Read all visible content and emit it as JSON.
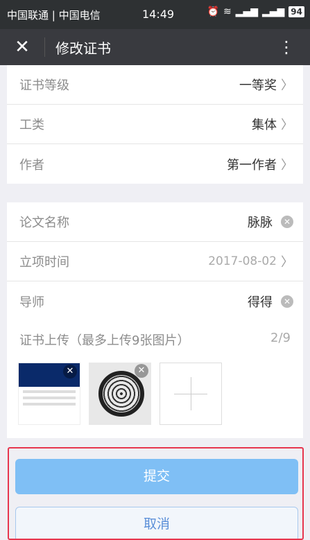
{
  "status_bar": {
    "carriers": "中国联通 | 中国电信",
    "time": "14:49",
    "icons": [
      "alarm-icon",
      "wifi-icon",
      "signal-icon",
      "signal-icon",
      "battery-icon"
    ],
    "battery": "94"
  },
  "nav": {
    "title": "修改证书",
    "close_icon": "close-icon",
    "more_icon": "more-vertical-icon"
  },
  "form": {
    "group1": [
      {
        "label": "证书等级",
        "value": "一等奖"
      },
      {
        "label": "工类",
        "value": "集体"
      },
      {
        "label": "作者",
        "value": "第一作者"
      }
    ],
    "group2": [
      {
        "label": "论文名称",
        "value": "脉脉"
      },
      {
        "label": "立项时间",
        "value": "2017-08-02"
      },
      {
        "label": "导师",
        "value": "得得"
      }
    ]
  },
  "upload": {
    "label": "证书上传（最多上传9张图片）",
    "count": "2/9"
  },
  "buttons": {
    "submit": "提交",
    "cancel": "取消"
  },
  "colors": {
    "nav_bg": "#393a3f",
    "submit_bg": "#7fbff5",
    "cancel_text": "#5b8fd8",
    "highlight_border": "#e7364e"
  }
}
